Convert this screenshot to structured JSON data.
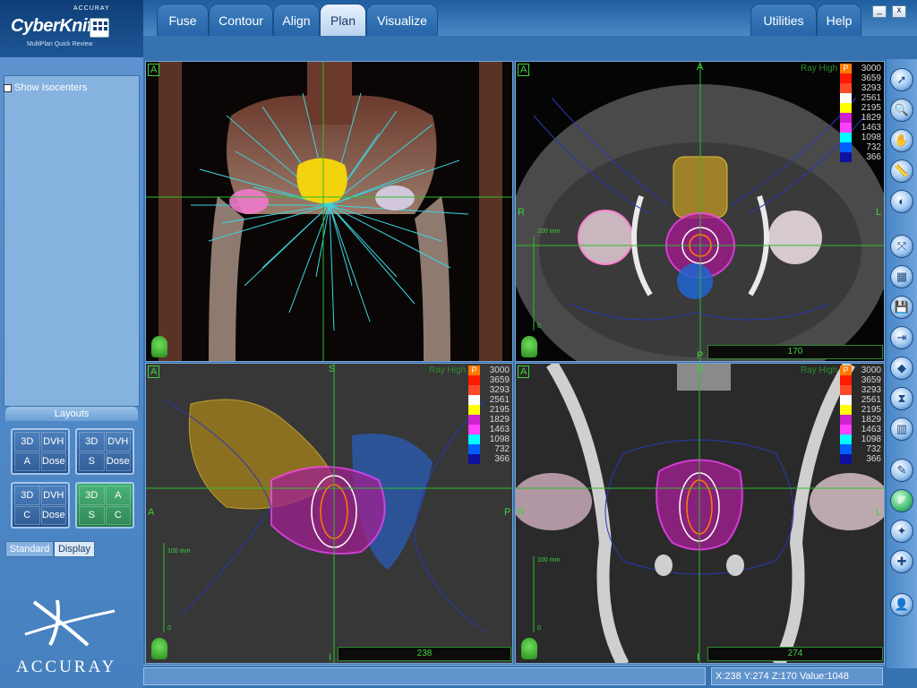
{
  "app": {
    "company": "ACCURAY",
    "brand": "CyberKnife",
    "subtitle": "MultiPlan Quick Review",
    "footer_brand": "ACCURAY"
  },
  "tabs": [
    "Fuse",
    "Contour",
    "Align",
    "Plan",
    "Visualize"
  ],
  "active_tab": "Plan",
  "right_tabs": [
    "Utilities",
    "Help"
  ],
  "window_buttons": {
    "minimize": "_",
    "close": "x"
  },
  "left_panel": {
    "show_isocenters_label": "Show Isocenters",
    "show_isocenters_checked": false,
    "layouts_header": "Layouts",
    "layouts": [
      {
        "cells": [
          "3D",
          "DVH",
          "A",
          "Dose"
        ],
        "active": false
      },
      {
        "cells": [
          "3D",
          "DVH",
          "S",
          "Dose"
        ],
        "active": false
      },
      {
        "cells": [
          "3D",
          "DVH",
          "C",
          "Dose"
        ],
        "active": false
      },
      {
        "cells": [
          "3D",
          "A",
          "S",
          "C"
        ],
        "active": true
      }
    ],
    "bottom_tabs": [
      "Standard",
      "Display"
    ],
    "active_bottom_tab": "Display"
  },
  "views": {
    "view3d": {
      "corner": "A"
    },
    "axial": {
      "corner": "A",
      "top": "A",
      "bottom": "P",
      "left": "R",
      "right": "L",
      "ray_label": "Ray High",
      "slice": "170",
      "scale": "100 mm",
      "scale_zero": "0"
    },
    "sagittal": {
      "corner": "A",
      "top": "S",
      "bottom": "I",
      "left": "A",
      "right": "P",
      "ray_label": "Ray High",
      "slice": "238",
      "scale": "100 mm",
      "scale_zero": "0"
    },
    "coronal": {
      "corner": "A",
      "top": "S",
      "bottom": "I",
      "left": "R",
      "right": "L",
      "ray_label": "Ray High",
      "slice": "274",
      "scale": "100 mm",
      "scale_zero": "0"
    }
  },
  "dose_legend": {
    "header": "P",
    "entries": [
      {
        "value": "3000",
        "color": "#ff7a00"
      },
      {
        "value": "3659",
        "color": "#ff1a00"
      },
      {
        "value": "3293",
        "color": "#ff4a2a"
      },
      {
        "value": "2561",
        "color": "#ffffff"
      },
      {
        "value": "2195",
        "color": "#ffff00"
      },
      {
        "value": "1829",
        "color": "#d020d0"
      },
      {
        "value": "1463",
        "color": "#ff40ff"
      },
      {
        "value": "1098",
        "color": "#00ffff"
      },
      {
        "value": "732",
        "color": "#0060ff"
      },
      {
        "value": "366",
        "color": "#1010a0"
      }
    ]
  },
  "toolbar": [
    {
      "name": "pointer-tool-icon",
      "glyph": "➚"
    },
    {
      "name": "zoom-tool-icon",
      "glyph": "🔍"
    },
    {
      "name": "pan-hand-icon",
      "glyph": "✋"
    },
    {
      "name": "ruler-icon",
      "glyph": "📏"
    },
    {
      "name": "window-level-icon",
      "glyph": "◐"
    },
    {
      "name": "fit-view-icon",
      "glyph": "⤧"
    },
    {
      "name": "print-icon",
      "glyph": "▦"
    },
    {
      "name": "save-icon",
      "glyph": "💾"
    },
    {
      "name": "export-icon",
      "glyph": "⇥"
    },
    {
      "name": "layers-icon",
      "glyph": "◆"
    },
    {
      "name": "hourglass-icon",
      "glyph": "⧗"
    },
    {
      "name": "dose-settings-icon",
      "glyph": "▥"
    },
    {
      "name": "contour-edit-icon",
      "glyph": "✎"
    },
    {
      "name": "beam-edit-icon",
      "glyph": "✐"
    },
    {
      "name": "beam-select-icon",
      "glyph": "✦"
    },
    {
      "name": "beam-add-icon",
      "glyph": "✚"
    },
    {
      "name": "user-icon",
      "glyph": "👤"
    }
  ],
  "status": {
    "coords": "X:238 Y:274 Z:170  Value:1048"
  }
}
